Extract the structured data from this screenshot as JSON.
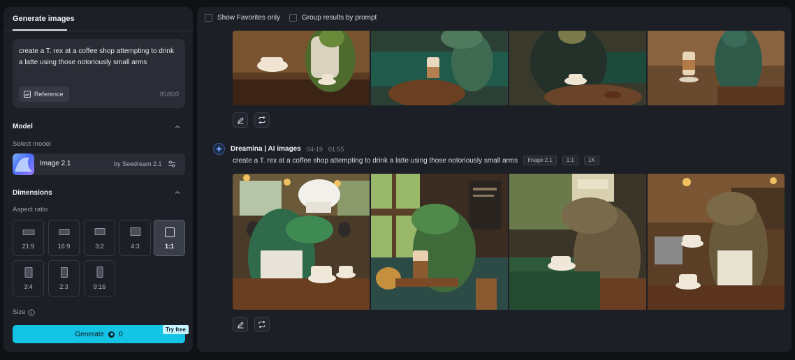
{
  "left_panel": {
    "tab_label": "Generate images",
    "prompt": {
      "text": "create a T. rex at a coffee shop attempting to drink a latte using those notoriously small arms",
      "reference_label": "Reference",
      "char_count": "95/800"
    },
    "model": {
      "section_title": "Model",
      "select_label": "Select model",
      "name": "Image 2.1",
      "by": "by Seedream 2.1"
    },
    "dimensions": {
      "section_title": "Dimensions",
      "aspect_label": "Aspect ratio",
      "ratios": [
        "21:9",
        "16:9",
        "3:2",
        "4:3",
        "1:1",
        "3:4",
        "2:3",
        "9:16"
      ],
      "selected_ratio": "1:1"
    },
    "size_label": "Size",
    "generate": {
      "label": "Generate",
      "cost": "0",
      "badge": "Try free",
      "color": "#14c4e4"
    }
  },
  "main": {
    "filters": {
      "favorites_label": "Show Favorites only",
      "group_label": "Group results by prompt"
    },
    "generation": {
      "brand": "Dreamina | AI images",
      "date": "04-19",
      "time": "01:55",
      "prompt": "create a T. rex at a coffee shop attempting to drink a latte using those notoriously small arms",
      "tags": [
        "Image 2.1",
        "1:1",
        "1K"
      ]
    }
  }
}
